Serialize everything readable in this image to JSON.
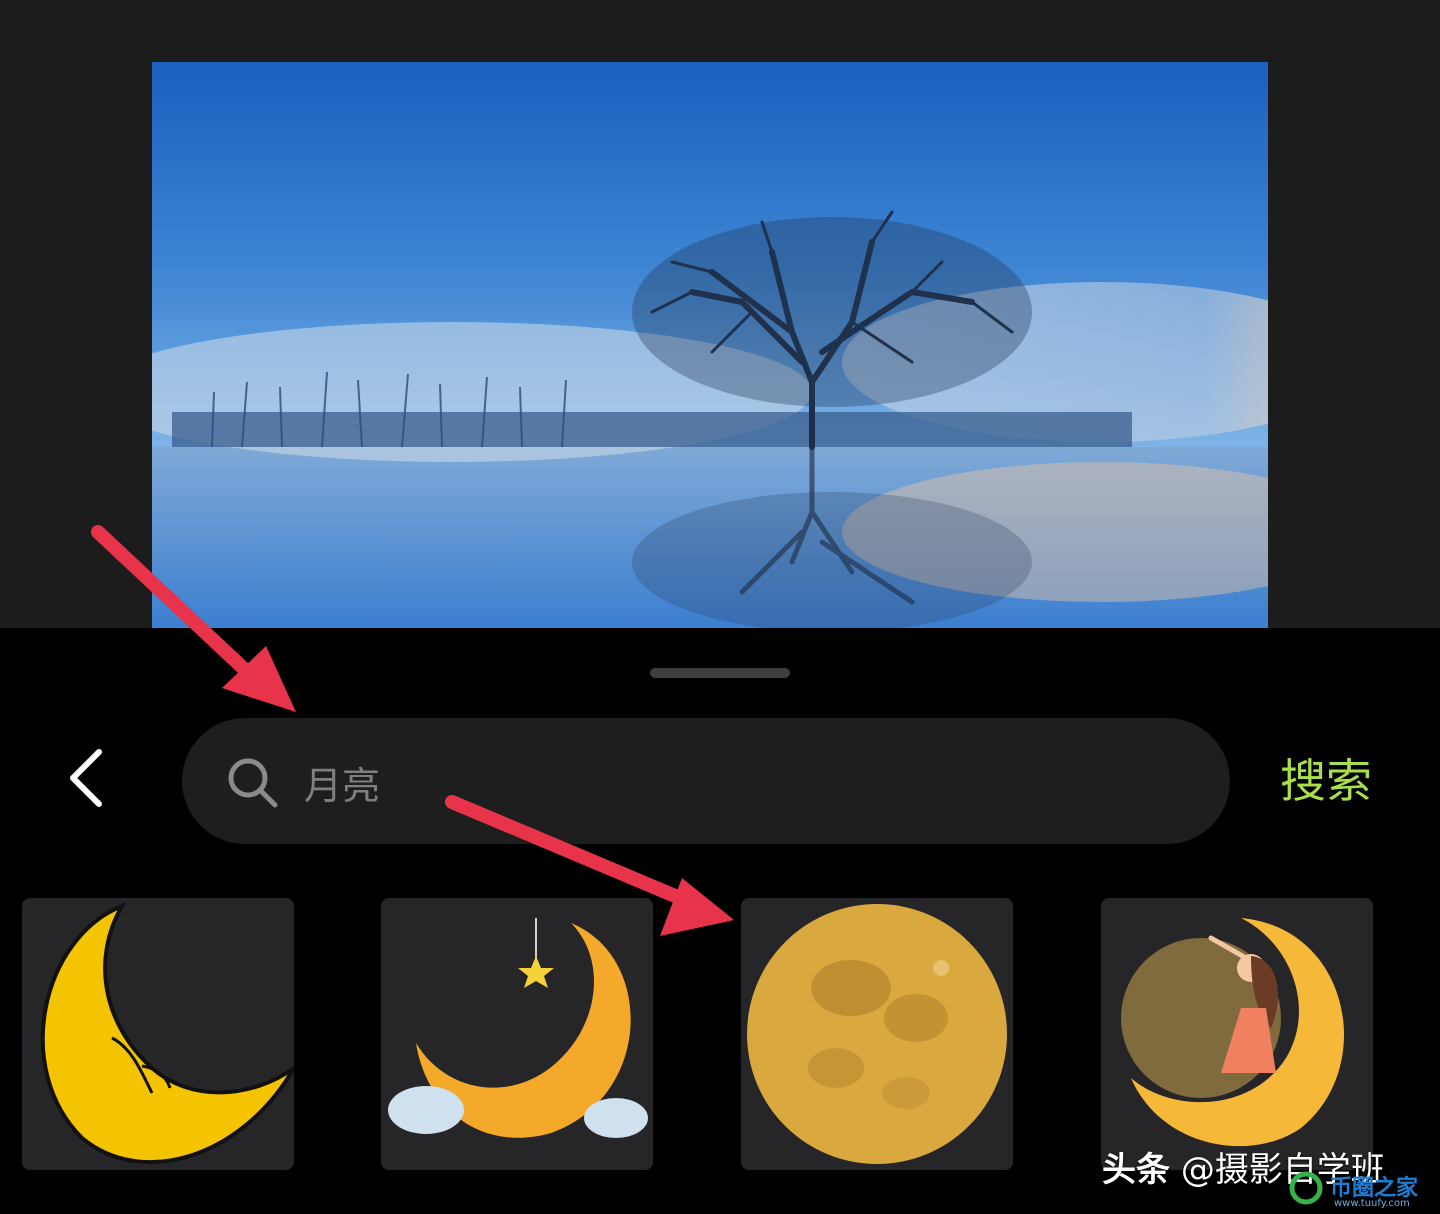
{
  "search": {
    "value": "月亮",
    "submit_label": "搜索"
  },
  "results": [
    {
      "name": "moon-face-sticker"
    },
    {
      "name": "crescent-star-sticker"
    },
    {
      "name": "full-moon-sticker"
    },
    {
      "name": "moon-girl-sticker"
    }
  ],
  "watermark": {
    "brand": "头条",
    "account": "@摄影自学班",
    "site_name": "币圈之家",
    "site_url": "www.tuufy.com"
  },
  "colors": {
    "accent": "#a8e04c",
    "annotation_arrow": "#e8344a"
  },
  "icons": [
    "back-chevron-icon",
    "search-icon"
  ]
}
